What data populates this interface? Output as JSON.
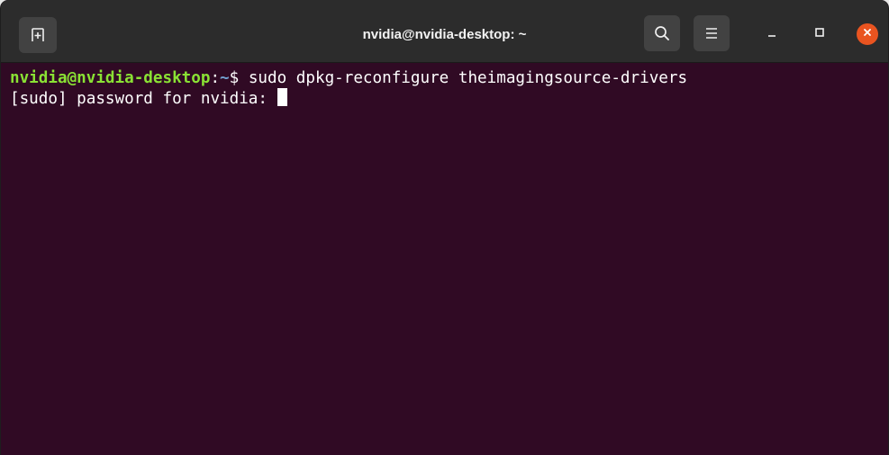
{
  "window": {
    "title": "nvidia@nvidia-desktop: ~"
  },
  "titlebar": {
    "new_tab_icon": "new-tab-icon",
    "search_icon": "search-icon",
    "menu_icon": "hamburger-menu-icon",
    "minimize_icon": "minimize-icon",
    "maximize_icon": "maximize-icon",
    "close_icon": "close-icon"
  },
  "terminal": {
    "lines": [
      {
        "user_host": "nvidia@nvidia-desktop",
        "colon": ":",
        "path": "~",
        "dollar": "$ ",
        "command": "sudo dpkg-reconfigure theimagingsource-drivers"
      },
      {
        "text": "[sudo] password for nvidia: "
      }
    ]
  },
  "colors": {
    "terminal_bg": "#300a24",
    "titlebar_bg": "#2c2c2c",
    "prompt_user": "#8ae234",
    "prompt_path": "#729fcf",
    "close_button": "#e95420",
    "text": "#ffffff"
  }
}
